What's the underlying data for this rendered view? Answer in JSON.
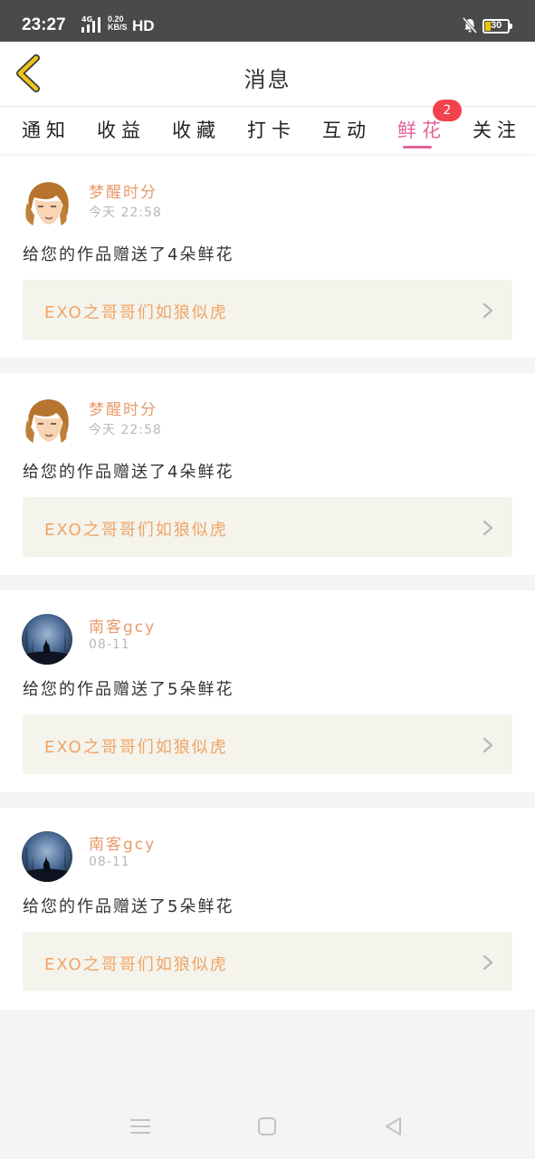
{
  "status_bar": {
    "time": "23:27",
    "network_type": "4G",
    "speed_value": "0.20",
    "speed_unit": "KB/S",
    "hd": "HD",
    "battery": "30",
    "mute_icon": "bell-off-icon",
    "battery_icon": "battery-icon"
  },
  "header": {
    "title": "消息",
    "back_icon": "chevron-left-icon",
    "back_color": "#f0c419"
  },
  "tabs": [
    {
      "label": "通知"
    },
    {
      "label": "收益"
    },
    {
      "label": "收藏"
    },
    {
      "label": "打卡"
    },
    {
      "label": "互动"
    },
    {
      "label": "鲜花",
      "active": true,
      "badge": "2"
    },
    {
      "label": "关注"
    }
  ],
  "accent_color": "#e2649a",
  "cards": [
    {
      "username": "梦醒时分",
      "time": "今天 22:58",
      "message": "给您的作品赠送了4朵鲜花",
      "work_title": "EXO之哥哥们如狼似虎",
      "avatar": "illustrated-face-avatar"
    },
    {
      "username": "梦醒时分",
      "time": "今天 22:58",
      "message": "给您的作品赠送了4朵鲜花",
      "work_title": "EXO之哥哥们如狼似虎",
      "avatar": "illustrated-face-avatar"
    },
    {
      "username": "南客gcy",
      "time": "08-11",
      "message": "给您的作品赠送了5朵鲜花",
      "work_title": "EXO之哥哥们如狼似虎",
      "avatar": "wolf-forest-avatar"
    },
    {
      "username": "南客gcy",
      "time": "08-11",
      "message": "给您的作品赠送了5朵鲜花",
      "work_title": "EXO之哥哥们如狼似虎",
      "avatar": "wolf-forest-avatar"
    }
  ],
  "nav_bar": {
    "menu_icon": "menu-icon",
    "home_icon": "home-square-icon",
    "back_icon": "back-triangle-icon"
  }
}
